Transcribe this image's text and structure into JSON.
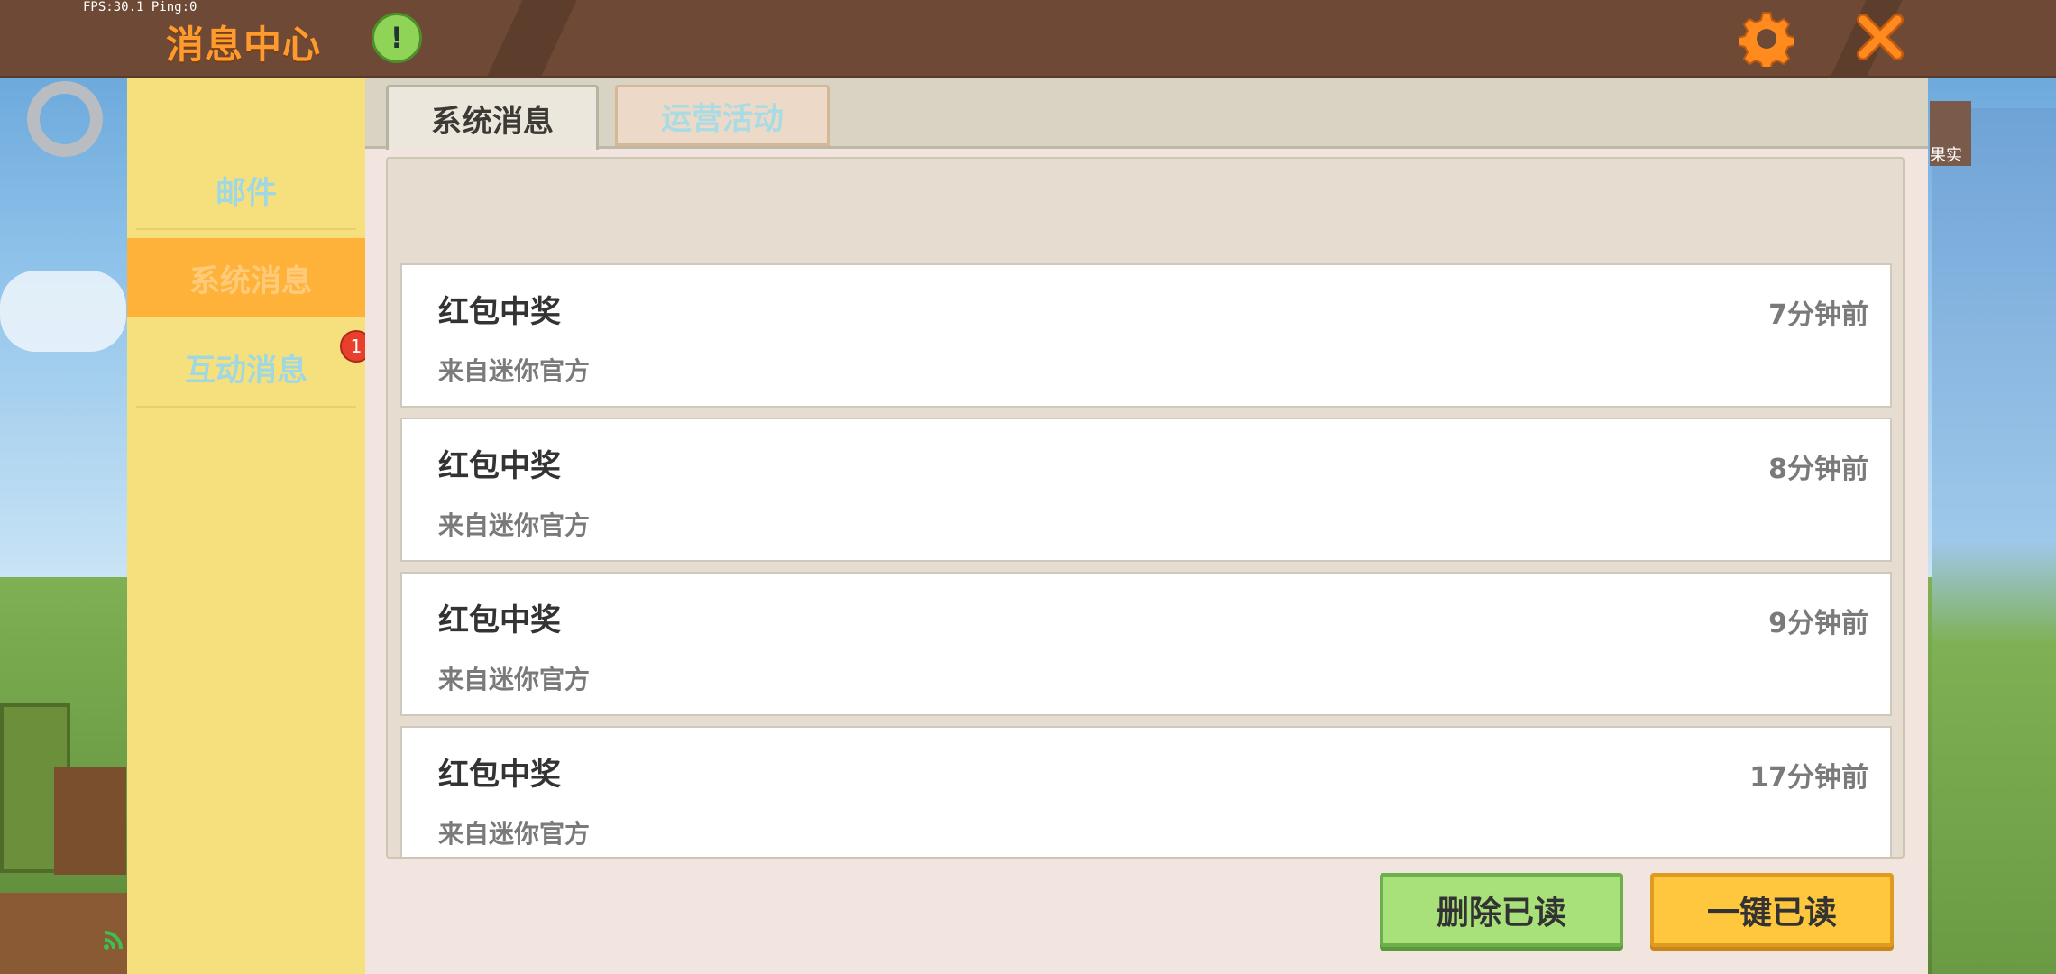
{
  "hud": {
    "fps_text": "FPS:30.1  Ping:0"
  },
  "header": {
    "title": "消息中心",
    "alert_symbol": "!",
    "settings_icon": "gear-icon",
    "close_icon": "close-icon"
  },
  "sidebar": {
    "items": [
      {
        "label": "邮件",
        "active": false
      },
      {
        "label": "系统消息",
        "active": true
      },
      {
        "label": "互动消息",
        "active": false,
        "badge": "1"
      }
    ]
  },
  "tabs": [
    {
      "label": "系统消息",
      "active": true
    },
    {
      "label": "运营活动",
      "active": false
    }
  ],
  "messages": [
    {
      "title": "红包中奖",
      "source": "来自迷你官方",
      "time": "7分钟前"
    },
    {
      "title": "红包中奖",
      "source": "来自迷你官方",
      "time": "8分钟前"
    },
    {
      "title": "红包中奖",
      "source": "来自迷你官方",
      "time": "9分钟前"
    },
    {
      "title": "红包中奖",
      "source": "来自迷你官方",
      "time": "17分钟前"
    }
  ],
  "actions": {
    "delete_read": "删除已读",
    "mark_all_read": "一键已读"
  },
  "edge_label": "果实",
  "colors": {
    "title_orange": "#ff9a2e",
    "sidebar_bg": "#f6e07d",
    "active_item": "#ffb23a",
    "green_button": "#a8e07a",
    "yellow_button": "#ffc73e",
    "badge_red": "#e8402c"
  }
}
